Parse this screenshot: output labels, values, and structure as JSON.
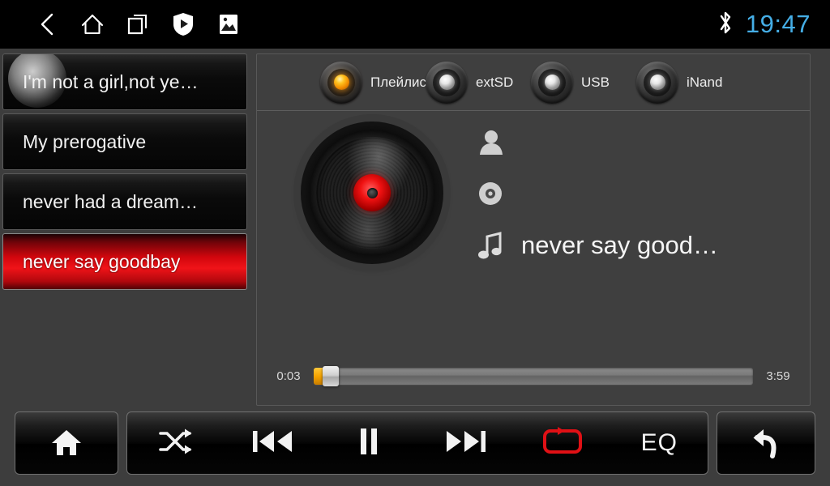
{
  "statusbar": {
    "nav_items": [
      {
        "name": "back-icon",
        "label": "Back"
      },
      {
        "name": "home-icon",
        "label": "Home"
      },
      {
        "name": "recents-icon",
        "label": "Recent apps"
      },
      {
        "name": "play-protect-shield-icon",
        "label": "Play Protect"
      },
      {
        "name": "gallery-image-icon",
        "label": "Gallery"
      }
    ],
    "bluetooth_icon": "bluetooth-icon",
    "clock": "19:47",
    "clock_color": "#45aee6"
  },
  "playlist": {
    "items": [
      {
        "title": "I'm not a girl,not ye…",
        "active": false,
        "ripple": true
      },
      {
        "title": "My prerogative",
        "active": false,
        "ripple": false
      },
      {
        "title": "never had a dream…",
        "active": false,
        "ripple": false
      },
      {
        "title": "never say goodbay",
        "active": true,
        "ripple": false
      }
    ],
    "active_color": "#ea0f15"
  },
  "sources": {
    "items": [
      {
        "label": "Плейлис…",
        "active": true
      },
      {
        "label": "extSD",
        "active": false
      },
      {
        "label": "USB",
        "active": false
      },
      {
        "label": "iNand",
        "active": false
      }
    ],
    "active_led_color": "#ffa014",
    "inactive_led_color": "#e6e6e6"
  },
  "nowplaying": {
    "artist": "",
    "album": "",
    "title": "never say good…",
    "artist_icon": "person-icon",
    "album_icon": "disc-icon",
    "title_icon": "music-note-icon",
    "album_art_icon": "vinyl-record-icon"
  },
  "progress": {
    "elapsed": "0:03",
    "total": "3:59",
    "percent": 1.3,
    "fill_color": "#f5a300"
  },
  "controls": {
    "home": {
      "label": "Home",
      "icon": "home-icon"
    },
    "buttons": [
      {
        "label": "Shuffle",
        "icon": "shuffle-icon",
        "active": false
      },
      {
        "label": "Previous",
        "icon": "previous-track-icon",
        "active": false
      },
      {
        "label": "Pause",
        "icon": "pause-icon",
        "active": false
      },
      {
        "label": "Next",
        "icon": "next-track-icon",
        "active": false
      },
      {
        "label": "Repeat",
        "icon": "repeat-icon",
        "active": true
      },
      {
        "label": "EQ",
        "icon": "equalizer-text",
        "active": false
      }
    ],
    "eq_label": "EQ",
    "back": {
      "label": "Back",
      "icon": "return-arrow-icon"
    },
    "active_color": "#e01015"
  }
}
